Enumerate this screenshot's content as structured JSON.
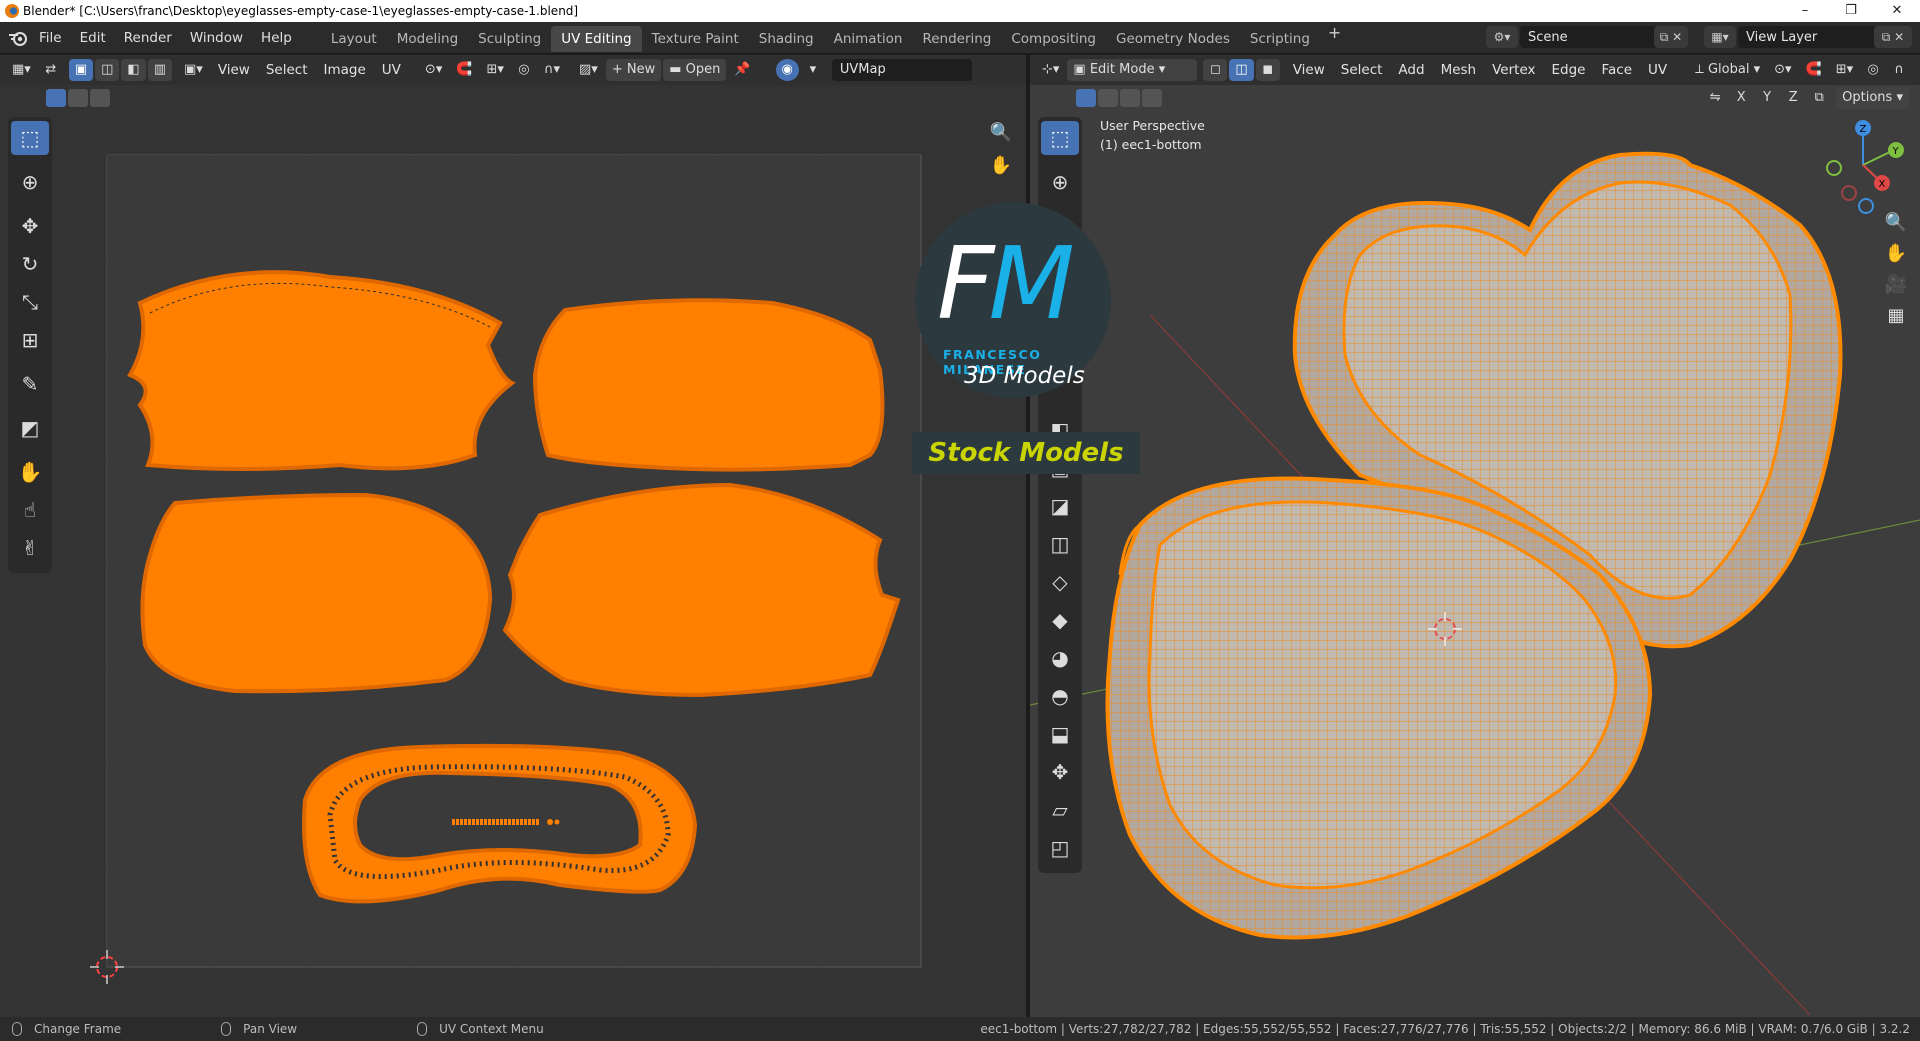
{
  "window": {
    "title": "Blender* [C:\\Users\\franc\\Desktop\\eyeglasses-empty-case-1\\eyeglasses-empty-case-1.blend]",
    "controls": [
      "–",
      "❐",
      "✕"
    ]
  },
  "topbar": {
    "menus": [
      "File",
      "Edit",
      "Render",
      "Window",
      "Help"
    ],
    "workspaces": [
      {
        "label": "Layout",
        "active": false
      },
      {
        "label": "Modeling",
        "active": false
      },
      {
        "label": "Sculpting",
        "active": false
      },
      {
        "label": "UV Editing",
        "active": true
      },
      {
        "label": "Texture Paint",
        "active": false
      },
      {
        "label": "Shading",
        "active": false
      },
      {
        "label": "Animation",
        "active": false
      },
      {
        "label": "Rendering",
        "active": false
      },
      {
        "label": "Compositing",
        "active": false
      },
      {
        "label": "Geometry Nodes",
        "active": false
      },
      {
        "label": "Scripting",
        "active": false
      }
    ],
    "add_workspace": "+",
    "scene": "Scene",
    "view_layer": "View Layer"
  },
  "uv_editor": {
    "menus": [
      "View",
      "Select",
      "Image",
      "UV"
    ],
    "new_label": "New",
    "open_label": "Open",
    "uvmap": "UVMap"
  },
  "viewport": {
    "mode": "Edit Mode",
    "menus": [
      "View",
      "Select",
      "Add",
      "Mesh",
      "Vertex",
      "Edge",
      "Face",
      "UV"
    ],
    "orientation": "Global",
    "options_label": "Options",
    "axes": [
      "X",
      "Y",
      "Z"
    ],
    "overlay_line1": "User Perspective",
    "overlay_line2": "(1) eec1-bottom"
  },
  "watermark": {
    "letters_f": "F",
    "letters_m": "M",
    "name": "FRANCESCO MILANESE",
    "tagline": "3D Models",
    "stock": "Stock Models"
  },
  "statusbar": {
    "items": [
      "Change Frame",
      "Pan View",
      "UV Context Menu"
    ],
    "stats": "eec1-bottom | Verts:27,782/27,782 | Edges:55,552/55,552 | Faces:27,776/27,776 | Tris:55,552 | Objects:2/2 | Memory: 86.6 MiB | VRAM: 0.7/6.0 GiB | 3.2.2"
  },
  "colors": {
    "uv_island": "#ff8000",
    "accent": "#4772b3",
    "mesh_wire": "#f08a1c",
    "mesh_face": "#b2a89f"
  },
  "icons": {
    "uv_tools": [
      "select-box-icon",
      "cursor-icon",
      "move-icon",
      "rotate-icon",
      "scale-icon",
      "transform-icon",
      "annotate-icon",
      "rip-region-icon",
      "grab-icon",
      "relax-icon",
      "pinch-icon"
    ],
    "view3d_tools": [
      "select-box-icon",
      "cursor-icon",
      "extrude-region-icon",
      "inset-faces-icon",
      "bevel-icon",
      "loop-cut-icon",
      "knife-icon",
      "poly-build-icon",
      "spin-icon",
      "smooth-icon",
      "edge-slide-icon",
      "shrink-fatten-icon",
      "shear-icon",
      "rip-icon"
    ]
  }
}
